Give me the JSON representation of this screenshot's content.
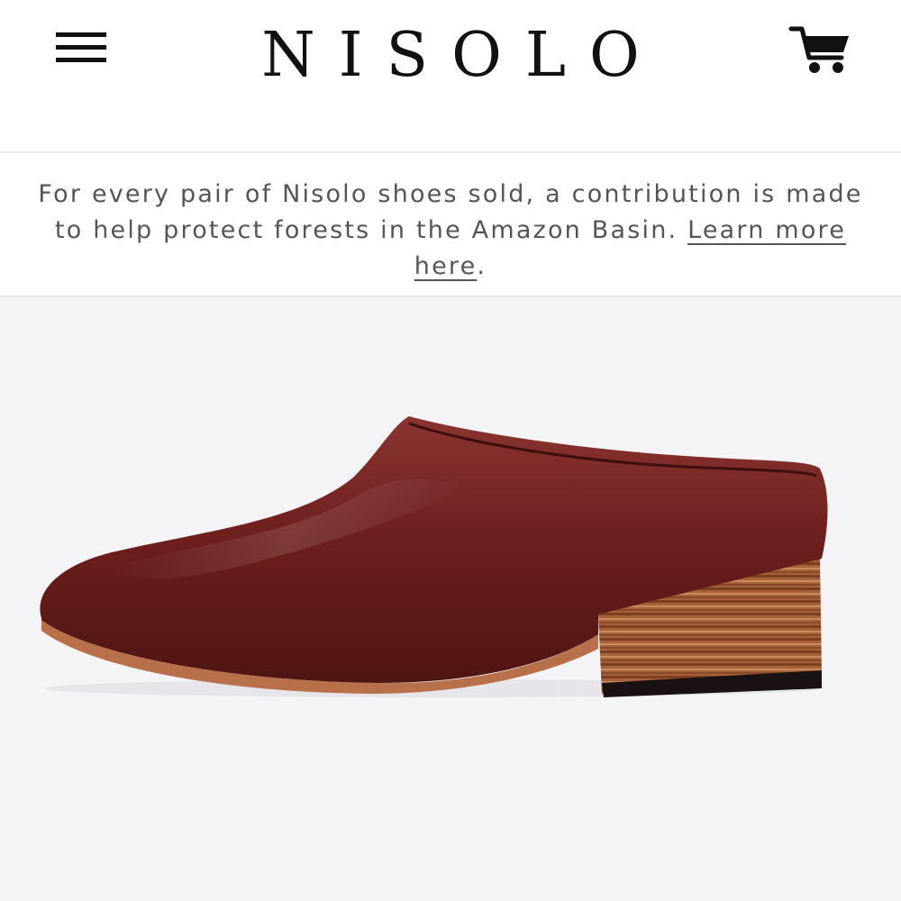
{
  "header": {
    "menu_icon": "hamburger-menu-icon",
    "brand": "NISOLO",
    "cart_icon": "shopping-cart-icon"
  },
  "promo": {
    "text": "For every pair of Nisolo shoes sold, a contribution is made to help protect forests in the Amazon Basin.",
    "link_text": "Learn more here",
    "trailing": "."
  },
  "hero": {
    "product_image": "burgundy-leather-mule-shoe",
    "colors": {
      "background": "#f4f4f7",
      "leather": "#6b1e1c",
      "heel_wood": "#a8623a",
      "sole": "#b8704a"
    }
  }
}
